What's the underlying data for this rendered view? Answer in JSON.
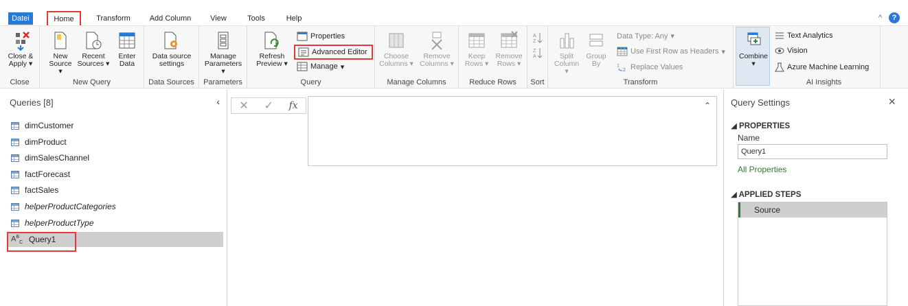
{
  "menu": {
    "tabs": [
      "Datei",
      "Home",
      "Transform",
      "Add Column",
      "View",
      "Tools",
      "Help"
    ],
    "help": "?",
    "collapse": "^"
  },
  "ribbon": {
    "close": {
      "label1": "Close &",
      "label2": "Apply",
      "group": "Close"
    },
    "new_query": {
      "new_source": [
        "New",
        "Source"
      ],
      "recent_sources": [
        "Recent",
        "Sources"
      ],
      "enter_data": [
        "Enter",
        "Data"
      ],
      "group": "New Query"
    },
    "data_sources": {
      "label1": "Data source",
      "label2": "settings",
      "group": "Data Sources"
    },
    "parameters": {
      "label1": "Manage",
      "label2": "Parameters",
      "group": "Parameters"
    },
    "query": {
      "refresh": [
        "Refresh",
        "Preview"
      ],
      "properties": "Properties",
      "advanced_editor": "Advanced Editor",
      "manage": "Manage",
      "group": "Query"
    },
    "manage_columns": {
      "choose": [
        "Choose",
        "Columns"
      ],
      "remove": [
        "Remove",
        "Columns"
      ],
      "group": "Manage Columns"
    },
    "reduce_rows": {
      "keep": [
        "Keep",
        "Rows"
      ],
      "remove": [
        "Remove",
        "Rows"
      ],
      "group": "Reduce Rows"
    },
    "sort": {
      "group": "Sort"
    },
    "transform": {
      "split": [
        "Split",
        "Column"
      ],
      "group_by": [
        "Group",
        "By"
      ],
      "data_type": "Data Type: Any",
      "first_row": "Use First Row as Headers",
      "replace": "Replace Values",
      "group": "Transform"
    },
    "ai": {
      "combine": "Combine",
      "text_analytics": "Text Analytics",
      "vision": "Vision",
      "azure_ml": "Azure Machine Learning",
      "group": "AI Insights"
    }
  },
  "queries": {
    "title": "Queries [8]",
    "items": [
      {
        "name": "dimCustomer",
        "type": "table"
      },
      {
        "name": "dimProduct",
        "type": "table"
      },
      {
        "name": "dimSalesChannel",
        "type": "table"
      },
      {
        "name": "factForecast",
        "type": "table"
      },
      {
        "name": "factSales",
        "type": "table"
      },
      {
        "name": "helperProductCategories",
        "type": "table"
      },
      {
        "name": "helperProductType",
        "type": "table"
      },
      {
        "name": "Query1",
        "type": "text"
      }
    ]
  },
  "formula": {
    "fx": "fx",
    "cancel": "✕",
    "confirm": "✓"
  },
  "settings": {
    "title": "Query Settings",
    "properties_header": "PROPERTIES",
    "name_label": "Name",
    "name_value": "Query1",
    "all_properties": "All Properties",
    "steps_header": "APPLIED STEPS",
    "steps": [
      "Source"
    ]
  },
  "colors": {
    "accent": "#2b79d6",
    "highlight": "#e23a3a",
    "step_marker": "#2e7d32"
  }
}
